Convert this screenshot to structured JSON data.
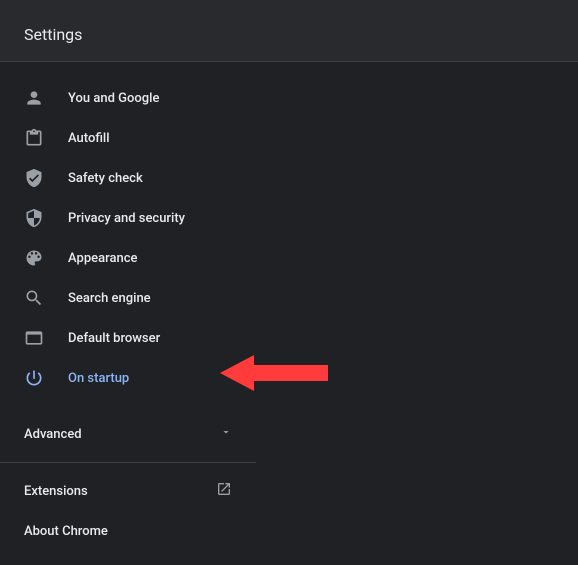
{
  "header": {
    "title": "Settings"
  },
  "sidebar": {
    "items": [
      {
        "label": "You and Google"
      },
      {
        "label": "Autofill"
      },
      {
        "label": "Safety check"
      },
      {
        "label": "Privacy and security"
      },
      {
        "label": "Appearance"
      },
      {
        "label": "Search engine"
      },
      {
        "label": "Default browser"
      },
      {
        "label": "On startup"
      }
    ],
    "advanced": "Advanced",
    "extensions": "Extensions",
    "about": "About Chrome"
  }
}
